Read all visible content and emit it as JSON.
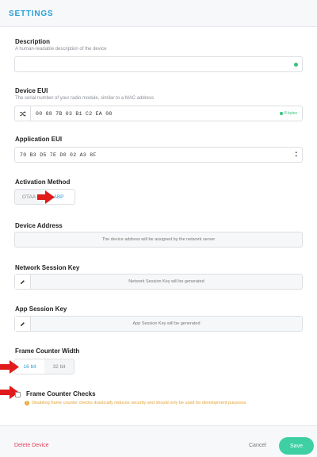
{
  "header": {
    "title": "SETTINGS"
  },
  "description": {
    "label": "Description",
    "hint": "A human-readable description of the device",
    "value": ""
  },
  "device_eui": {
    "label": "Device EUI",
    "hint": "The serial number of your radio module, similar to a MAC address",
    "value": "00 88 7B 03 B1 C2 EA 08",
    "byte_count": "8 bytes",
    "prefix_icon": "shuffle-icon"
  },
  "application_eui": {
    "label": "Application EUI",
    "value": "70 B3 D5 7E D0 02 A3 8F"
  },
  "activation_method": {
    "label": "Activation Method",
    "options": [
      "OTAA",
      "ABP"
    ],
    "selected": "ABP"
  },
  "device_address": {
    "label": "Device Address",
    "placeholder": "The device address will be assigned by the network server"
  },
  "network_session_key": {
    "label": "Network Session Key",
    "placeholder": "Network Session Key will be generated",
    "prefix_icon": "pencil-icon"
  },
  "app_session_key": {
    "label": "App Session Key",
    "placeholder": "App Session Key will be generated",
    "prefix_icon": "pencil-icon"
  },
  "frame_counter_width": {
    "label": "Frame Counter Width",
    "options": [
      "16 bit",
      "32 bit"
    ],
    "selected": "16 bit"
  },
  "frame_counter_checks": {
    "label": "Frame Counter Checks",
    "checked": false,
    "warning": "Disabling frame counter checks drastically reduces security and should only be used for development purposes"
  },
  "footer": {
    "delete_label": "Delete Device",
    "cancel_label": "Cancel",
    "save_label": "Save"
  },
  "colors": {
    "accent": "#2a9fd8",
    "success": "#37c27b",
    "warning": "#e0a234",
    "danger": "#e0435a",
    "save": "#3ed0a3",
    "annotation_arrow": "#e11b1b"
  }
}
